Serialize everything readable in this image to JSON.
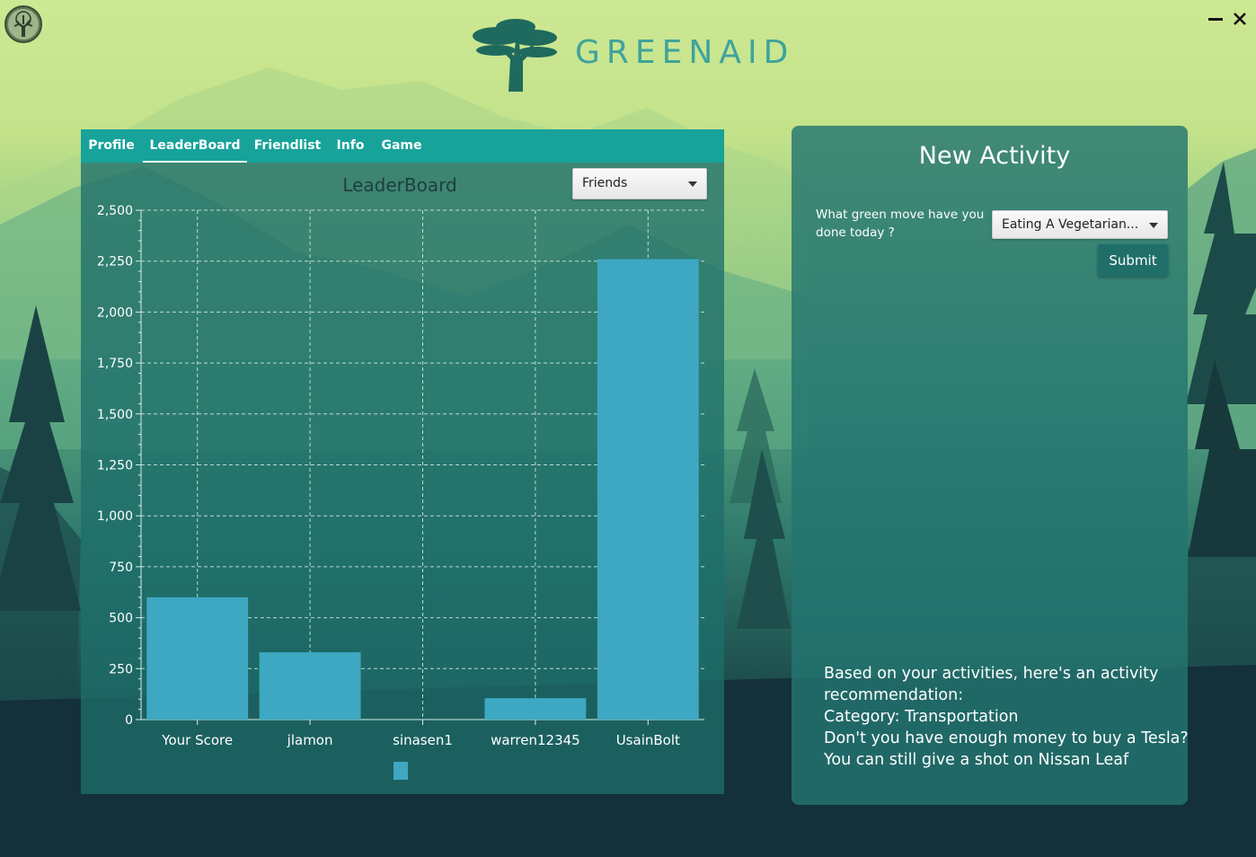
{
  "window": {
    "app_icon": "tree-emblem-icon",
    "minimize_icon": "minimize-icon",
    "close_icon": "close-icon"
  },
  "logo": {
    "text": "GREENAID",
    "icon": "acacia-tree-icon",
    "color": "#3fa39b"
  },
  "tabs": [
    {
      "label": "Profile",
      "active": false
    },
    {
      "label": "LeaderBoard",
      "active": true
    },
    {
      "label": "Friendlist",
      "active": false
    },
    {
      "label": "Info",
      "active": false
    },
    {
      "label": "Game",
      "active": false
    }
  ],
  "leaderboard": {
    "title": "LeaderBoard",
    "filter_select": {
      "selected": "Friends"
    }
  },
  "chart_data": {
    "type": "bar",
    "title": "LeaderBoard",
    "categories": [
      "Your Score",
      "jlamon",
      "sinasen1",
      "warren12345",
      "UsainBolt"
    ],
    "series": [
      {
        "values": [
          600,
          330,
          0,
          105,
          2260
        ]
      }
    ],
    "ylim": [
      0,
      2500
    ],
    "yticks": [
      "0",
      "250",
      "500",
      "750",
      "1,000",
      "1,250",
      "1,500",
      "1,750",
      "2,000",
      "2,250",
      "2,500"
    ],
    "grid": true,
    "legend": "bottom",
    "bar_color": "#3ea8c2"
  },
  "new_activity": {
    "title": "New Activity",
    "question": "What green move have you done today ?",
    "activity_select": {
      "selected": "Eating A Vegetarian..."
    },
    "submit_label": "Submit",
    "recommendation": [
      "Based on your activities, here's an activity",
      "recommendation:",
      "Category: Transportation",
      "Don't you have enough money to buy a Tesla?",
      "You can still give a shot on Nissan Leaf"
    ]
  }
}
